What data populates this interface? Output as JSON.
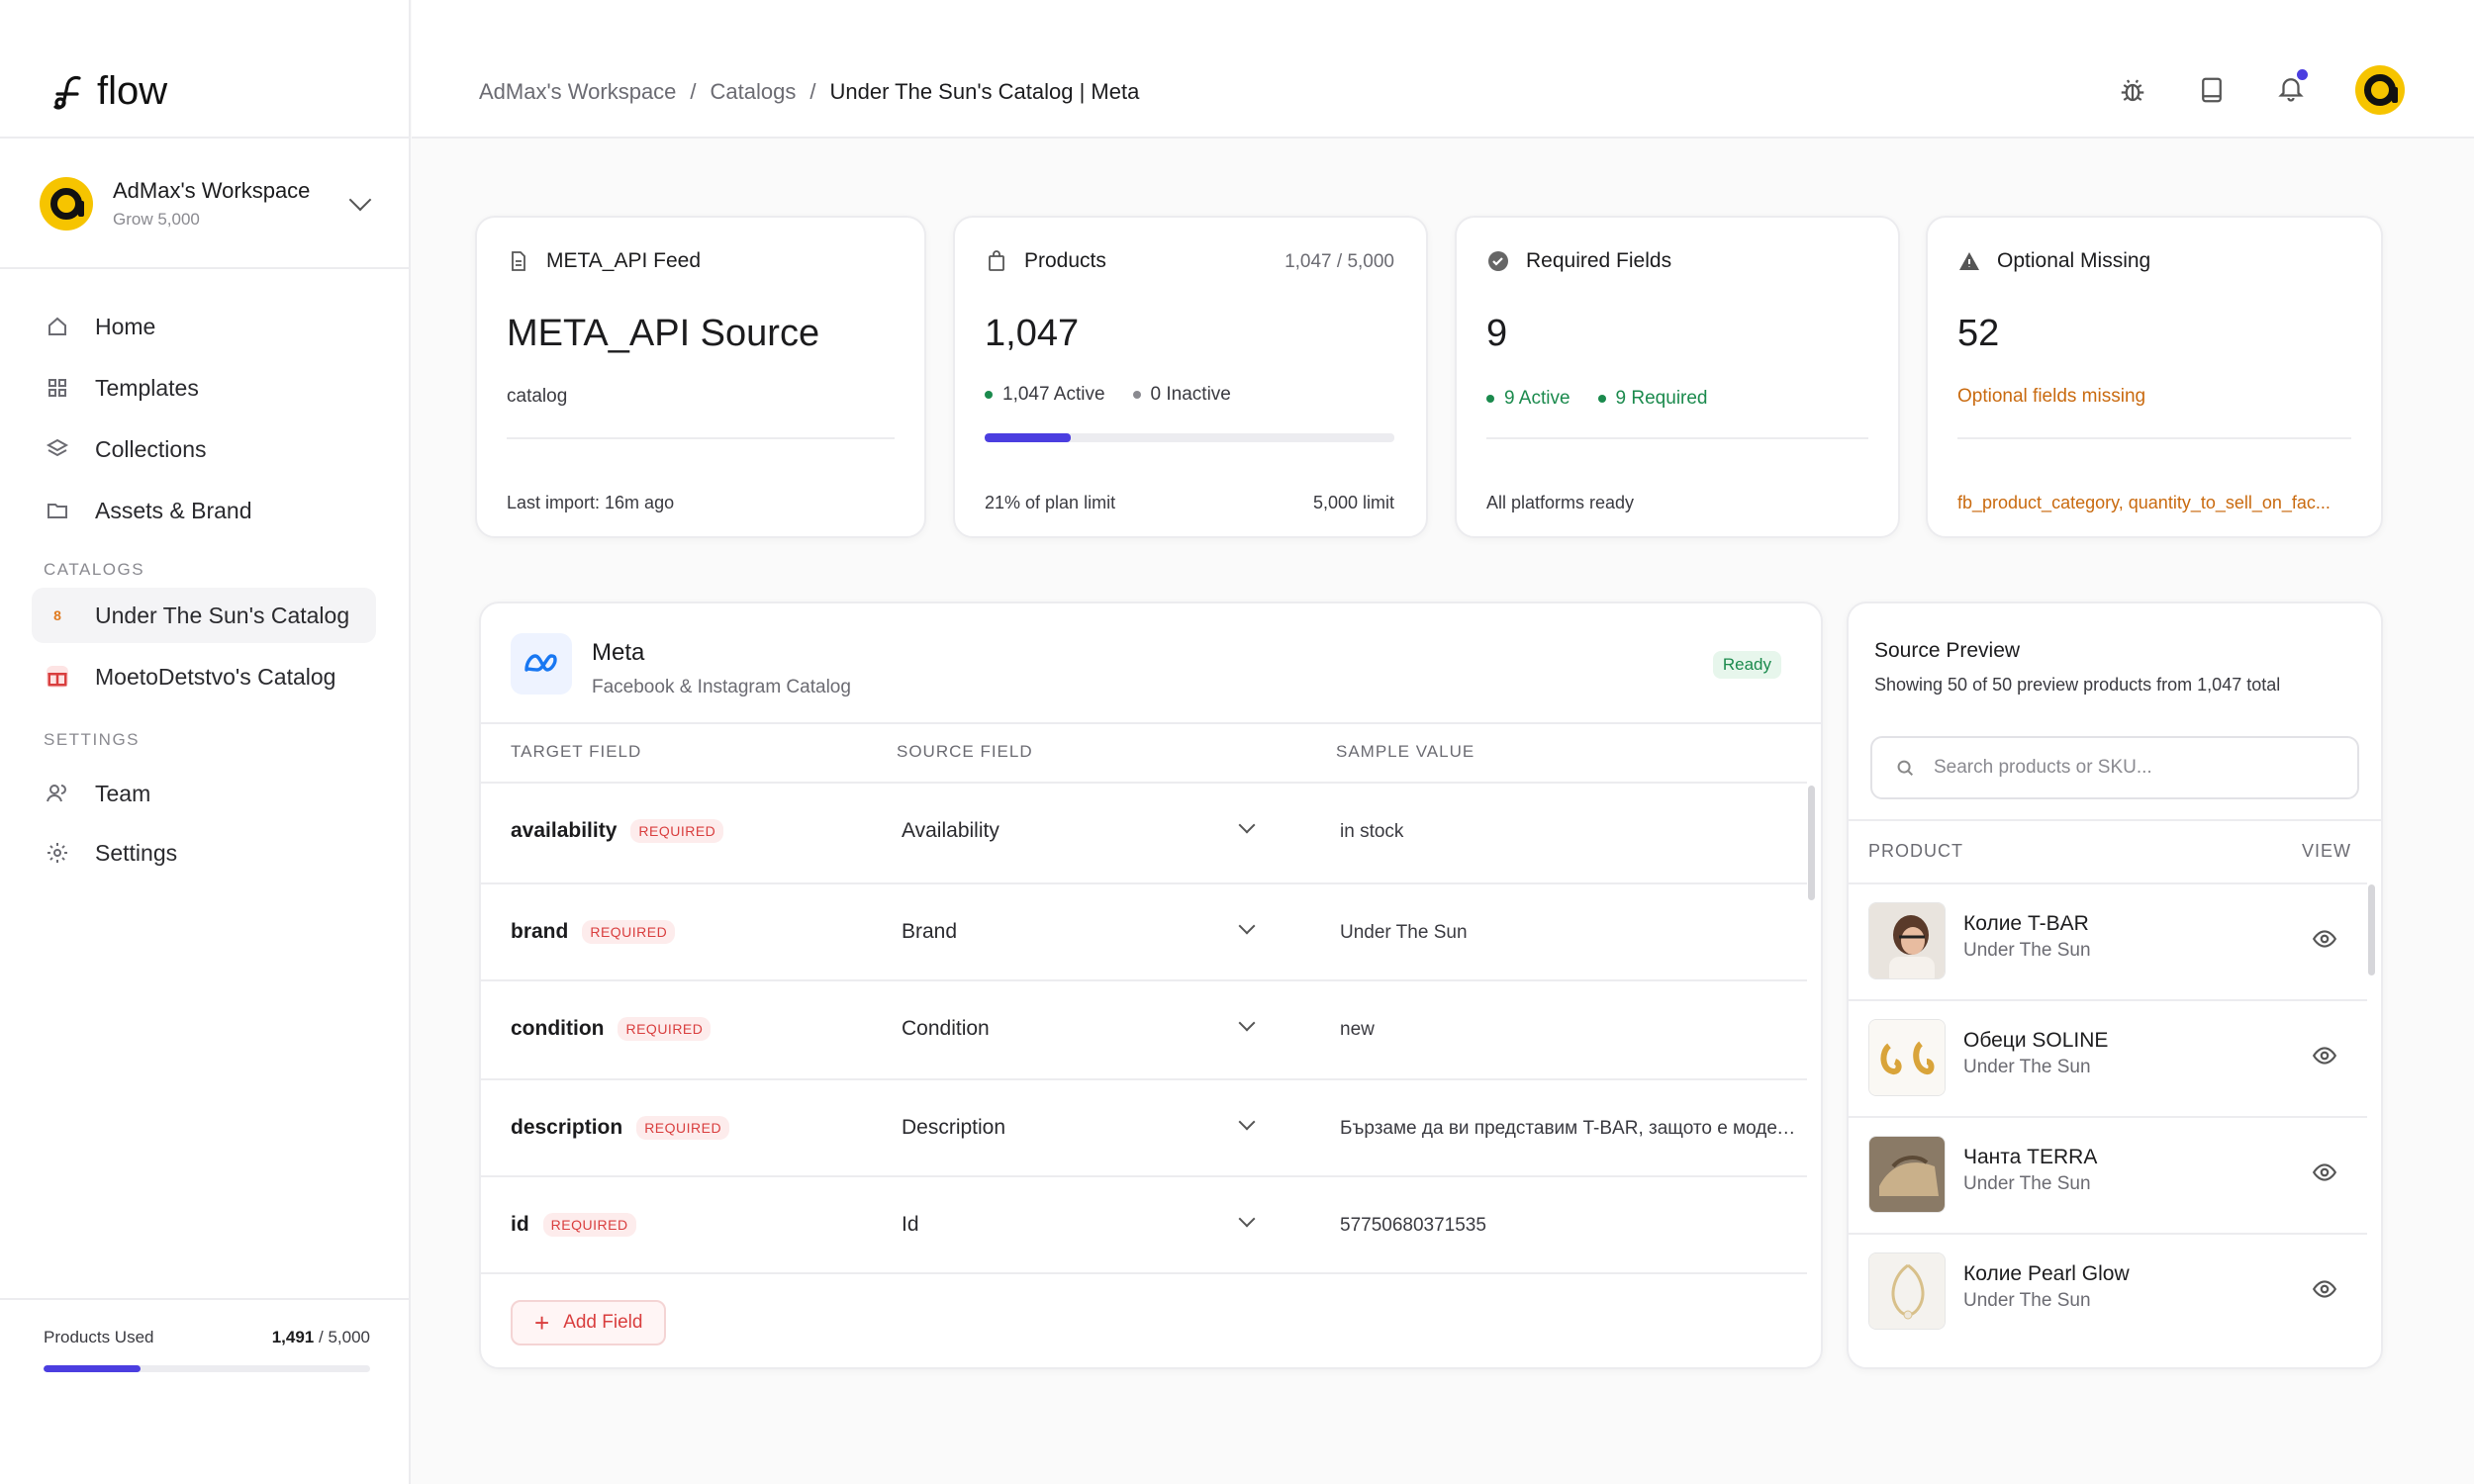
{
  "app": {
    "logo_text": "flow"
  },
  "workspace": {
    "name": "AdMax's Workspace",
    "plan": "Grow 5,000"
  },
  "nav": {
    "home": "Home",
    "templates": "Templates",
    "collections": "Collections",
    "assets": "Assets & Brand",
    "catalogs_label": "CATALOGS",
    "catalog_1": {
      "badge": "8",
      "name": "Under The Sun's Catalog"
    },
    "catalog_2": {
      "name": "MoetoDetstvo's Catalog"
    },
    "settings_label": "SETTINGS",
    "team": "Team",
    "settings": "Settings"
  },
  "usage": {
    "label": "Products Used",
    "used": "1,491",
    "total": "/ 5,000",
    "fraction": 0.298
  },
  "breadcrumb": {
    "c1": "AdMax's Workspace",
    "sep": "/",
    "c2": "Catalogs",
    "c3": "Under The Sun's Catalog | Meta"
  },
  "stats": {
    "feed": {
      "title": "META_API Feed",
      "value": "META_API Source",
      "sub": "catalog",
      "foot": "Last import: 16m ago"
    },
    "products": {
      "title": "Products",
      "right": "1,047 / 5,000",
      "value": "1,047",
      "active": "1,047 Active",
      "inactive": "0 Inactive",
      "progress": 0.21,
      "foot_left": "21% of plan limit",
      "foot_right": "5,000 limit"
    },
    "required": {
      "title": "Required Fields",
      "value": "9",
      "active": "9 Active",
      "required": "9 Required",
      "foot": "All platforms ready"
    },
    "optional": {
      "title": "Optional Missing",
      "value": "52",
      "sub": "Optional fields missing",
      "foot": "fb_product_category, quantity_to_sell_on_fac..."
    }
  },
  "mapping": {
    "platform": "Meta",
    "platform_sub": "Facebook & Instagram Catalog",
    "status": "Ready",
    "headers": {
      "target": "TARGET FIELD",
      "source": "SOURCE FIELD",
      "sample": "SAMPLE VALUE"
    },
    "required_tag": "REQUIRED",
    "rows": [
      {
        "target": "availability",
        "source": "Availability",
        "sample": "in stock"
      },
      {
        "target": "brand",
        "source": "Brand",
        "sample": "Under The Sun"
      },
      {
        "target": "condition",
        "source": "Condition",
        "sample": "new"
      },
      {
        "target": "description",
        "source": "Description",
        "sample": "Бързаме да ви представим T-BAR, защото е модел, вд..."
      },
      {
        "target": "id",
        "source": "Id",
        "sample": "57750680371535"
      }
    ],
    "add_field": "Add Field"
  },
  "preview": {
    "title": "Source Preview",
    "subtitle": "Showing 50 of 50 preview products from 1,047 total",
    "search_placeholder": "Search products or SKU...",
    "headers": {
      "product": "PRODUCT",
      "view": "VIEW"
    },
    "products": [
      {
        "name": "Колие T-BAR",
        "brand": "Under The Sun"
      },
      {
        "name": "Обеци SOLINE",
        "brand": "Under The Sun"
      },
      {
        "name": "Чанта TERRA",
        "brand": "Under The Sun"
      },
      {
        "name": "Колие Pearl Glow",
        "brand": "Under The Sun"
      }
    ]
  },
  "colors": {
    "accent": "#4b3ee0",
    "brand_yellow": "#f6c400",
    "success": "#1b8a4d",
    "danger": "#d93e3e",
    "warning": "#c96a0f"
  }
}
